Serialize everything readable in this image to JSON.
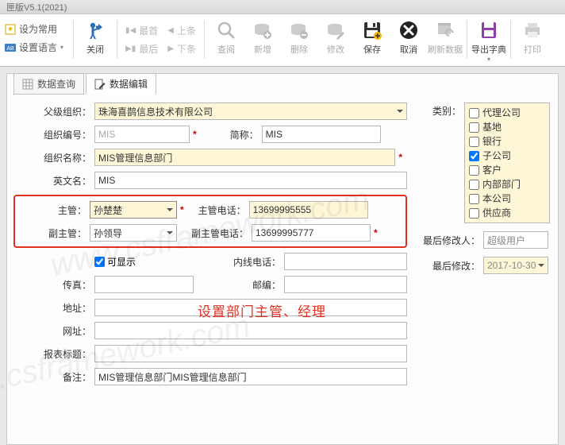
{
  "title": "匣版V5.1(2021)",
  "small_tools": {
    "common": "设为常用",
    "lang": "设置语言"
  },
  "nav": {
    "first": "最首",
    "last": "最后",
    "prev": "上条",
    "next": "下条"
  },
  "big_tools": {
    "close": "关闭",
    "search": "查阅",
    "add": "新增",
    "delete": "删除",
    "modify": "修改",
    "save": "保存",
    "cancel": "取消",
    "refresh": "刷新数据",
    "export": "导出字典",
    "print": "打印"
  },
  "tabs": {
    "query": "数据查询",
    "edit": "数据编辑"
  },
  "labels": {
    "parent": "父级组织：",
    "code": "组织编号：",
    "short": "简称：",
    "name": "组织名称：",
    "en": "英文名：",
    "mgr": "主管：",
    "mgr_tel": "主管电话：",
    "vmgr": "副主管：",
    "vmgr_tel": "副主管电话：",
    "visible": "可显示",
    "inline_tel": "内线电话：",
    "fax": "传真：",
    "zip": "邮编：",
    "addr": "地址：",
    "web": "网址：",
    "report": "报表标题：",
    "remark": "备注：",
    "category": "类别：",
    "last_user": "最后修改人：",
    "last_time": "最后修改："
  },
  "values": {
    "parent": "珠海喜鹊信息技术有限公司",
    "code": "MIS",
    "short": "MIS",
    "name": "MIS管理信息部门",
    "en": "MIS",
    "mgr": "孙楚楚",
    "mgr_tel": "13699995555",
    "vmgr": "孙领导",
    "vmgr_tel": "13699995777",
    "remark": "MIS管理信息部门MIS管理信息部门",
    "last_user": "超级用户",
    "last_time": "2017-10-30"
  },
  "categories": [
    {
      "label": "代理公司",
      "checked": false
    },
    {
      "label": "基地",
      "checked": false
    },
    {
      "label": "银行",
      "checked": false
    },
    {
      "label": "子公司",
      "checked": true
    },
    {
      "label": "客户",
      "checked": false
    },
    {
      "label": "内部部门",
      "checked": false
    },
    {
      "label": "本公司",
      "checked": false
    },
    {
      "label": "供应商",
      "checked": false
    }
  ],
  "annotation": "设置部门主管、经理",
  "watermark": "www.csframework.com"
}
